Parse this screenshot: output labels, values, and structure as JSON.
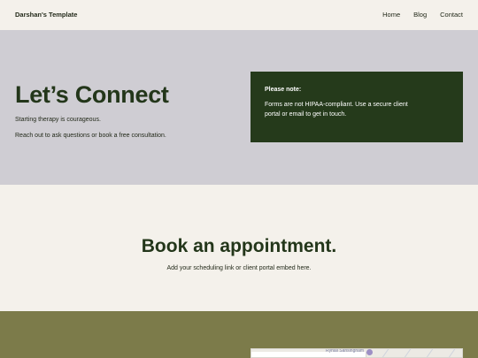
{
  "header": {
    "site_title": "Darshan's Template",
    "nav": [
      {
        "label": "Home"
      },
      {
        "label": "Blog"
      },
      {
        "label": "Contact"
      }
    ]
  },
  "hero": {
    "title": "Let’s Connect",
    "subtitle_1": "Starting therapy is courageous.",
    "subtitle_2": "Reach out to ask questions or book a free consultation."
  },
  "note": {
    "title": "Please note:",
    "body": "Forms are not HIPAA-compliant. Use a secure client portal or email to get in touch."
  },
  "booking": {
    "title": "Book an appointment.",
    "subtitle": "Add your scheduling link or client portal embed here."
  },
  "map": {
    "label": "Ryhall Sansingham"
  },
  "colors": {
    "background": "#f4f1eb",
    "hero_bg": "#cfcdd3",
    "dark_green": "#253a1b",
    "footer_olive": "#7c7b4a"
  }
}
